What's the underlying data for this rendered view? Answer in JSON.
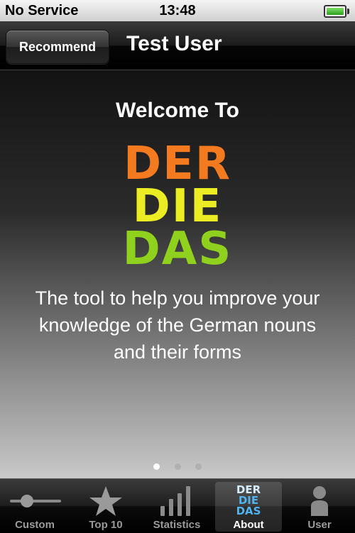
{
  "status_bar": {
    "carrier": "No Service",
    "time": "13:48",
    "battery_level": 1.0
  },
  "nav_bar": {
    "left_button": "Recommend",
    "title": "Test User"
  },
  "content": {
    "welcome": "Welcome To",
    "logo_lines": [
      {
        "text": "DER",
        "color": "#f47a1f"
      },
      {
        "text": "DIE",
        "color": "#ecec24"
      },
      {
        "text": "DAS",
        "color": "#8fd11c"
      }
    ],
    "tagline": "The tool to help you improve your knowledge of the German nouns and their forms",
    "page_indicator": {
      "count": 3,
      "active": 0
    }
  },
  "tab_bar": {
    "selected": "About",
    "tabs": [
      {
        "label": "Custom",
        "icon": "slider-icon"
      },
      {
        "label": "Top 10",
        "icon": "star-icon"
      },
      {
        "label": "Statistics",
        "icon": "bar-chart-icon"
      },
      {
        "label": "About",
        "icon": "derdiedas-logo-icon",
        "icon_text": [
          "DER",
          "DIE",
          "DAS"
        ]
      },
      {
        "label": "User",
        "icon": "person-icon"
      }
    ]
  }
}
